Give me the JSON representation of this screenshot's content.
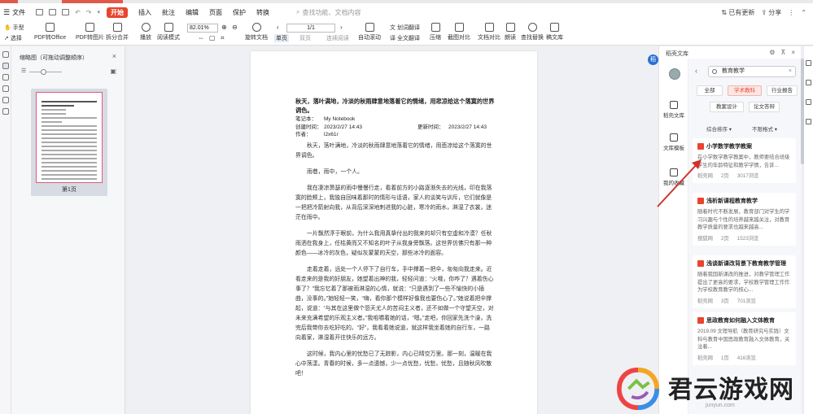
{
  "menu": {
    "file": "文件",
    "items": [
      "开始",
      "插入",
      "批注",
      "编辑",
      "页面",
      "保护",
      "转换"
    ],
    "active": "开始",
    "search_placeholder": "查找功能、文档内容",
    "sync": "已有更新",
    "share": "分享"
  },
  "toolbar": {
    "hand": "手型",
    "select": "选择",
    "pdf_office": "PDF转Office",
    "pdf_image": "PDF转图片",
    "split_merge": "拆分合并",
    "play": "播放",
    "read_mode": "阅读模式",
    "zoom": "82.01%",
    "rotate": "旋转文档",
    "single": "单页",
    "double": "双页",
    "continuous": "连续阅读",
    "page": "1/1",
    "auto_scroll": "自动滚动",
    "translate": "划词翻译",
    "full_translate": "全文翻译",
    "compress": "压缩",
    "compare": "截图对比",
    "doc_compare": "文档对比",
    "read_aloud": "朗读",
    "find_replace": "查找替换",
    "library": "稿文库"
  },
  "thumbs": {
    "title": "缩略图（可拖动调整顺序）",
    "page_label": "第1页"
  },
  "document": {
    "title": "秋天，落叶满地，冷淡的秋雨肆意地落着它的情绪，用悲凉给这个落寞的世界调色。",
    "meta": {
      "notebook_k": "笔记本：",
      "notebook_v": "My Notebook",
      "created_k": "创建时间：",
      "created_v": "2023/2/27 14:43",
      "updated_k": "更新时间：",
      "updated_v": "2023/2/27 14:43",
      "author_k": "作者：",
      "author_v": "l2x61r"
    },
    "paragraphs": [
      "秋天，落叶满地，冷淡的秋雨肆意地落着它的情绪，用悲凉给这个落寞的世界调色。",
      "雨巷，雨中，一个人。",
      "我在凄凉萧瑟的雨中慢慢行走，看着前方的小路逐渐失去的光线，印在我落寞的脸颊上，我独自回味着那时的情形与话语，家人的谈笑与训斥，它们就像是一把把冷箭射向我，从背后深深地刺进我的心脏，寒冷的雨水，淋湿了衣裳，迷茫在雨中。",
      "一片飘然浮于眼前，为什么我用真挚付出的我来的却只有空虚和冷漠？任秋雨洒在我身上，任枯黄而又不知名的叶子从我身旁飘落。这世界仿佛只有那一种颜色——冰冷的灰色，疑似灰蒙蒙的天空，那些冰冷的面容。",
      "走着走着，远处一个人停下了自行车，手中撑着一把伞，匆匆向我走来。近看走来的是我的好朋友，她望着出神的我，轻轻问道：“火哦，你咋了？遇着伤心事了？”我忘忆着了那被雨淋湿的心情，就说：“只是遇到了一些不愉快的小插曲，没事的。”她轻轻一笑，“嗨，看你那个模样好像我也要伤心了。”她说着把伞撑起，说道：“与其在这里做个怨天尤人的苦闷主义者，还不如做一个守望天空，对未来充满希望的乐观主义者。”我咀嚼着她的话，“嗯。”走吧，你回家先洗个澡，洗完后我带你去吃好吃的。“好”，我看着她说道，就这样我坐着她的自行车，一路向着家，淋湿着开往快乐的远方。",
      "这时候，我内心里的忧愁已了无踪影，内心已晴空万里。那一刻，温暖在我心中荡漾。青春的时候，多一点遗憾，少一点忧愁，忧愁，忧愁，且随秋风吹散吧！"
    ]
  },
  "panel": {
    "title": "稻壳文库",
    "nav": [
      "稻壳文库",
      "文库模板",
      "我的收藏"
    ],
    "search_value": "教育教学",
    "filters": [
      "全部",
      "学术教科",
      "行业报告",
      "教案设计",
      "论文答辩"
    ],
    "active_filter": "学术教科",
    "sort": "综合排序",
    "pay": "不限格式",
    "cards": [
      {
        "title": "小学数学教学教案",
        "desc": "在小学数学教学教案中，教师要结合班级学生的年龄特征和教学学情，告诉...",
        "source": "稻壳网",
        "pages": "2页",
        "views": "3017浏览"
      },
      {
        "title": "浅析新课程教育教学",
        "desc": "随着时代不断发展，教育部门对学生的学习兴趣与个性的培养越来越关注，对教育教学质量的要求也越来越高...",
        "source": "搜狐网",
        "pages": "2页",
        "views": "1523浏览"
      },
      {
        "title": "浅谈新课改背景下教育教学管理",
        "desc": "随着我国新课改的推进，对教学管理工作提出了更高的要求，学校教学管理工作作为学校教育教学的核心...",
        "source": "稻壳网",
        "pages": "3页",
        "views": "701浏览"
      },
      {
        "title": "思政教育如何融入文体教育",
        "desc": "2019.09 文理导航（教育研究与实践）文科与教育中国思政教育融入文体教育，关注着...",
        "source": "稻壳网",
        "pages": "1页",
        "views": "416浏览"
      }
    ]
  },
  "watermark": {
    "text": "君云游戏网",
    "sub": "junyun.com"
  }
}
